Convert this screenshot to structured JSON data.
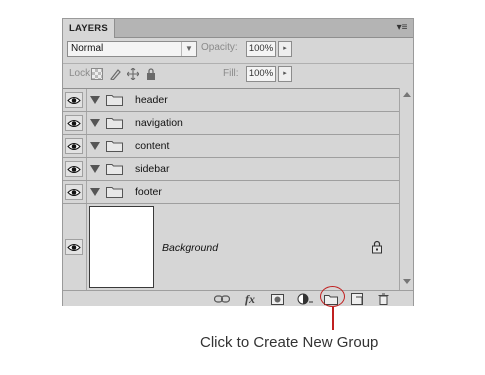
{
  "panel": {
    "tab_label": "LAYERS",
    "menu_glyph": "▾≡"
  },
  "blend": {
    "mode": "Normal",
    "opacity_label": "Opacity:",
    "opacity_value": "100%"
  },
  "lock": {
    "label": "Lock:",
    "fill_label": "Fill:",
    "fill_value": "100%"
  },
  "layers": [
    {
      "name": "header",
      "type": "group",
      "visible": true
    },
    {
      "name": "navigation",
      "type": "group",
      "visible": true
    },
    {
      "name": "content",
      "type": "group",
      "visible": true
    },
    {
      "name": "sidebar",
      "type": "group",
      "visible": true
    },
    {
      "name": "footer",
      "type": "group",
      "visible": true
    }
  ],
  "background_layer": {
    "name": "Background",
    "locked": true,
    "visible": true
  },
  "footer_buttons": [
    {
      "id": "link-layers",
      "icon": "link-icon"
    },
    {
      "id": "layer-style",
      "icon": "fx-icon",
      "label": "fx"
    },
    {
      "id": "layer-mask",
      "icon": "mask-icon"
    },
    {
      "id": "adjustment-layer",
      "icon": "adjustment-icon"
    },
    {
      "id": "new-group",
      "icon": "folder-icon"
    },
    {
      "id": "new-layer",
      "icon": "new-layer-icon"
    },
    {
      "id": "delete-layer",
      "icon": "trash-icon"
    }
  ],
  "annotation": {
    "text": "Click to Create New Group",
    "color": "#c02020"
  }
}
